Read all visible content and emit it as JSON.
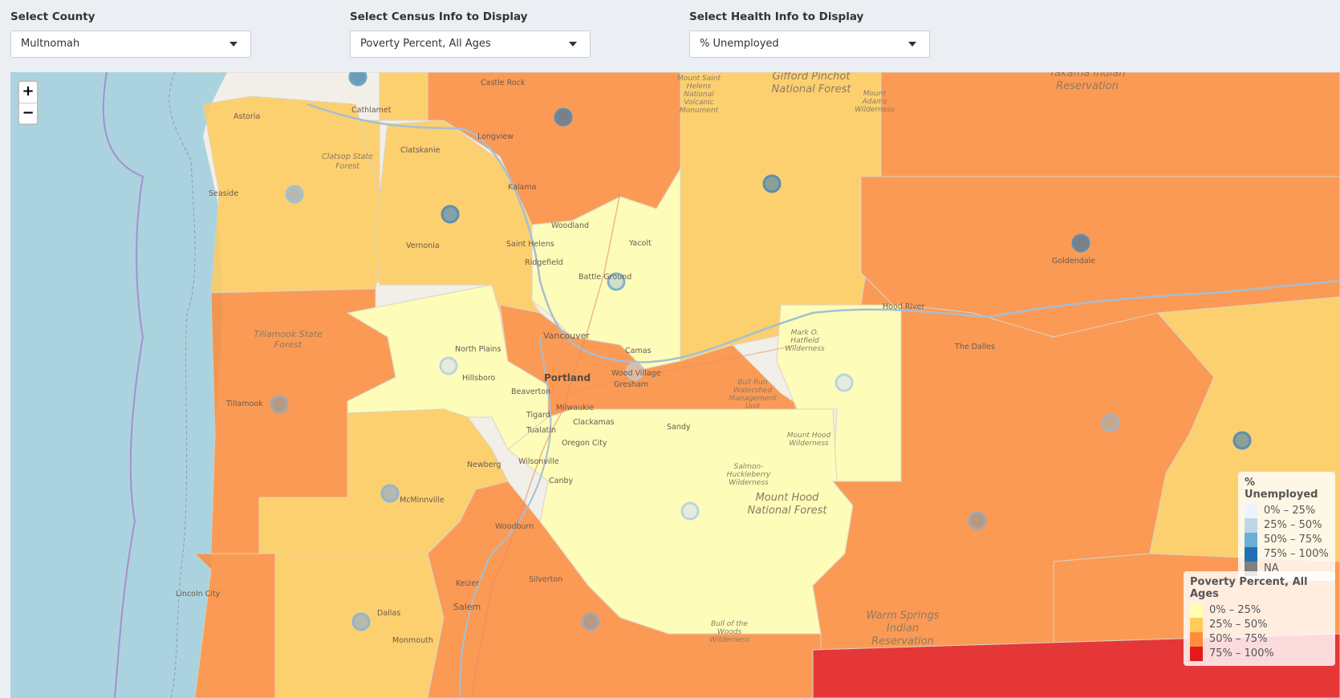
{
  "controls": {
    "county": {
      "label": "Select County",
      "value": "Multnomah"
    },
    "census": {
      "label": "Select Census Info to Display",
      "value": "Poverty Percent, All Ages"
    },
    "health": {
      "label": "Select Health Info to Display",
      "value": "% Unemployed"
    }
  },
  "zoom": {
    "in": "+",
    "out": "−"
  },
  "legend_health": {
    "title": "% Unemployed",
    "items": [
      {
        "label": "0% – 25%",
        "color": "#eff3ff"
      },
      {
        "label": "25% – 50%",
        "color": "#bdd7e7"
      },
      {
        "label": "50% – 75%",
        "color": "#6baed6"
      },
      {
        "label": "75% – 100%",
        "color": "#2171b5"
      },
      {
        "label": "NA",
        "color": "#808080"
      }
    ]
  },
  "legend_census": {
    "title": "Poverty Percent, All Ages",
    "items": [
      {
        "label": "0% – 25%",
        "color": "#ffffb2"
      },
      {
        "label": "25% – 50%",
        "color": "#fecc5c"
      },
      {
        "label": "50% – 75%",
        "color": "#fd8d3c"
      },
      {
        "label": "75% – 100%",
        "color": "#e31a1c"
      }
    ]
  },
  "places": {
    "castle_rock": "Castle Rock",
    "astoria": "Astoria",
    "cathlamet": "Cathlamet",
    "longview": "Longview",
    "clatskanie": "Clatskanie",
    "seaside": "Seaside",
    "kalama": "Kalama",
    "woodland": "Woodland",
    "yacolt": "Yacolt",
    "vernonia": "Vernonia",
    "saint_helens": "Saint Helens",
    "ridgefield": "Ridgefield",
    "battle_ground": "Battle Ground",
    "vancouver": "Vancouver",
    "camas": "Camas",
    "north_plains": "North Plains",
    "hillsboro": "Hillsboro",
    "portland": "Portland",
    "wood_village": "Wood Village",
    "gresham": "Gresham",
    "beaverton": "Beaverton",
    "tigard": "Tigard",
    "milwaukie": "Milwaukie",
    "clackamas": "Clackamas",
    "tualatin": "Tualatin",
    "sandy": "Sandy",
    "oregon_city": "Oregon City",
    "wilsonville": "Wilsonville",
    "newberg": "Newberg",
    "canby": "Canby",
    "mcminnville": "McMinnville",
    "woodburn": "Woodburn",
    "silverton": "Silverton",
    "keizer": "Keizer",
    "salem": "Salem",
    "dallas": "Dallas",
    "monmouth": "Monmouth",
    "tillamook": "Tillamook",
    "lincoln_city": "Lincoln City",
    "goldendale": "Goldendale",
    "the_dalles": "The Dalles",
    "hood_river": "Hood River",
    "gifford": "Gifford Pinchot National Forest",
    "yakama": "Yakama Indian Reservation",
    "tillamook_sf": "Tillamook State Forest",
    "clatsop_sf": "Clatsop State Forest",
    "mt_hood_nf": "Mount Hood National Forest",
    "warm_springs": "Warm Springs Indian Reservation",
    "bull_run": "Bull Run Watershed Management Unit",
    "mark_hatfield": "Mark O. Hatfield Wilderness",
    "mt_hood_wild": "Mount Hood Wilderness",
    "salmon_huckleberry": "Salmon-Huckleberry Wilderness",
    "bull_of_woods": "Bull of the Woods Wilderness",
    "mt_st_helens": "Mount Saint Helens National Volcanic Monument",
    "mt_adams": "Mount Adams Wilderness"
  }
}
